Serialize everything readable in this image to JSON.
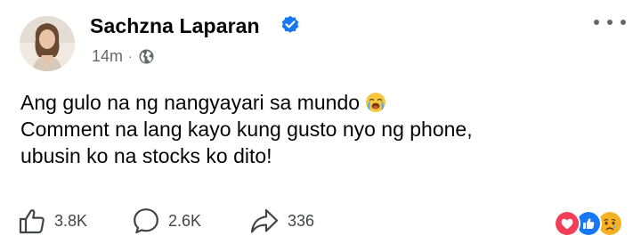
{
  "post": {
    "author": {
      "name": "Sachzna Laparan",
      "verified": true,
      "avatar_icon": "profile-photo"
    },
    "meta": {
      "time": "14m",
      "separator": "·",
      "audience_icon": "globe-icon"
    },
    "more_icon": "more-horizontal-icon",
    "body": {
      "line1": "Ang gulo na ng nangyayari sa mundo",
      "line1_emoji": "loudly-crying-face",
      "line2": "Comment na lang kayo kung gusto nyo ng phone,",
      "line3": "ubusin ko na stocks ko dito!"
    },
    "actions": {
      "like": {
        "icon": "thumbs-up-icon",
        "count": "3.8K"
      },
      "comment": {
        "icon": "comment-bubble-icon",
        "count": "2.6K"
      },
      "share": {
        "icon": "share-arrow-icon",
        "count": "336"
      }
    },
    "reactions": [
      "love",
      "like",
      "sad"
    ],
    "colors": {
      "text": "#050505",
      "secondary": "#65676b",
      "verified": "#1877f2",
      "love": "#f33e58",
      "like": "#1877f2",
      "sad": "#f7b125"
    }
  }
}
